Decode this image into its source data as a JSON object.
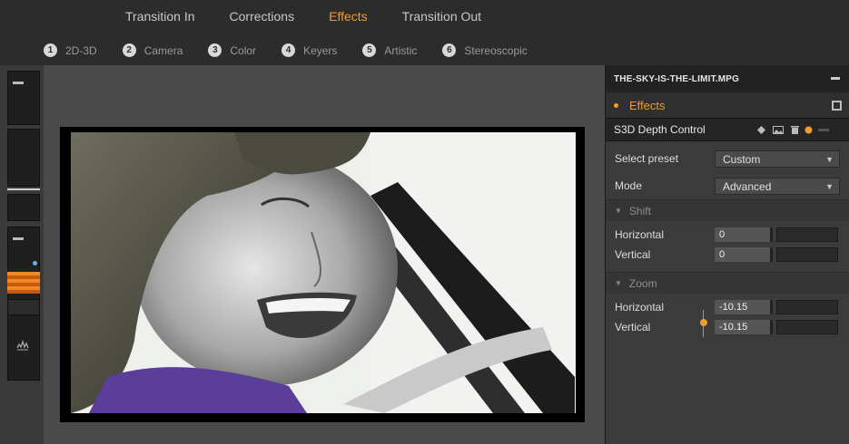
{
  "tabs": [
    "Transition In",
    "Corrections",
    "Effects",
    "Transition Out"
  ],
  "active_tab": "Effects",
  "subtabs": [
    {
      "num": "1",
      "label": "2D-3D"
    },
    {
      "num": "2",
      "label": "Camera"
    },
    {
      "num": "3",
      "label": "Color"
    },
    {
      "num": "4",
      "label": "Keyers"
    },
    {
      "num": "5",
      "label": "Artistic"
    },
    {
      "num": "6",
      "label": "Stereoscopic"
    }
  ],
  "panel": {
    "file_name": "THE-SKY-IS-THE-LIMIT.MPG",
    "effects_label": "Effects",
    "control_title": "S3D Depth Control",
    "preset_label": "Select preset",
    "preset_value": "Custom",
    "mode_label": "Mode",
    "mode_value": "Advanced",
    "shift": {
      "title": "Shift",
      "horizontal_label": "Horizontal",
      "horizontal_value": "0",
      "vertical_label": "Vertical",
      "vertical_value": "0"
    },
    "zoom": {
      "title": "Zoom",
      "horizontal_label": "Horizontal",
      "horizontal_value": "-10.15",
      "vertical_label": "Vertical",
      "vertical_value": "-10.15"
    }
  },
  "colors": {
    "accent": "#f39a2b",
    "panel_bg": "#3b3b3b",
    "preview_bg": "#4a4a4a"
  },
  "icons": [
    "pin-icon",
    "image-icon",
    "trash-icon",
    "power-icon",
    "save-icon",
    "link-icon",
    "audio-waveform-icon"
  ]
}
